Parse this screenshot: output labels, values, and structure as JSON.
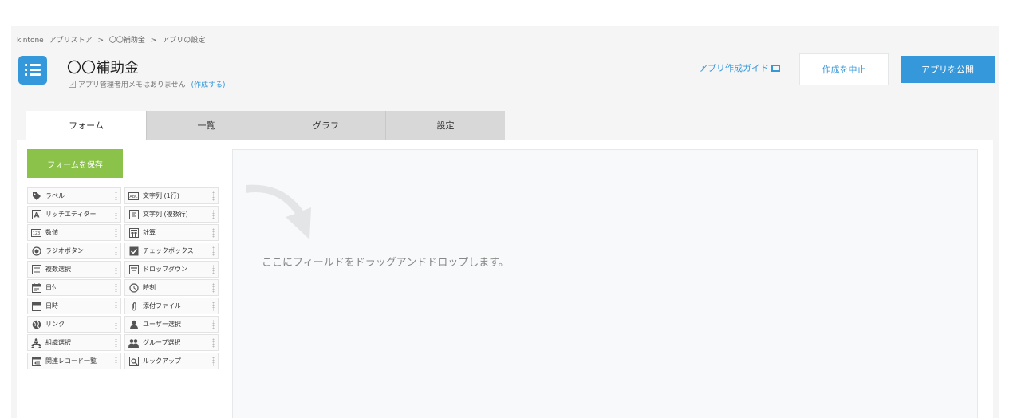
{
  "breadcrumb": [
    {
      "label": "kintone"
    },
    {
      "label": "アプリストア"
    },
    {
      "label": ">"
    },
    {
      "label": "〇〇補助金"
    },
    {
      "label": ">"
    },
    {
      "label": "アプリの設定"
    }
  ],
  "app": {
    "title": "〇〇補助金",
    "memo": "アプリ管理者用メモはありません",
    "memo_link": "(作成する)",
    "icon": "list-icon"
  },
  "header": {
    "guide_link": "アプリ作成ガイド",
    "cancel_label": "作成を中止",
    "publish_label": "アプリを公開"
  },
  "tabs": [
    {
      "label": "フォーム"
    },
    {
      "label": "一覧"
    },
    {
      "label": "グラフ"
    },
    {
      "label": "設定"
    }
  ],
  "form": {
    "save_label": "フォームを保存",
    "drop_hint": "ここにフィールドをドラッグアンドドロップします。",
    "fields": [
      {
        "label": "ラベル",
        "icon": "tag-icon"
      },
      {
        "label": "文字列 (1行)",
        "icon": "abc-icon"
      },
      {
        "label": "リッチエディター",
        "icon": "letter-a-icon"
      },
      {
        "label": "文字列 (複数行)",
        "icon": "multiline-text-icon"
      },
      {
        "label": "数値",
        "icon": "number-icon"
      },
      {
        "label": "計算",
        "icon": "calculator-icon"
      },
      {
        "label": "ラジオボタン",
        "icon": "radio-icon"
      },
      {
        "label": "チェックボックス",
        "icon": "checkbox-icon"
      },
      {
        "label": "複数選択",
        "icon": "multi-select-icon"
      },
      {
        "label": "ドロップダウン",
        "icon": "dropdown-icon"
      },
      {
        "label": "日付",
        "icon": "calendar-icon"
      },
      {
        "label": "時刻",
        "icon": "clock-icon"
      },
      {
        "label": "日時",
        "icon": "datetime-icon"
      },
      {
        "label": "添付ファイル",
        "icon": "paperclip-icon"
      },
      {
        "label": "リンク",
        "icon": "globe-icon"
      },
      {
        "label": "ユーザー選択",
        "icon": "user-icon"
      },
      {
        "label": "組織選択",
        "icon": "org-icon"
      },
      {
        "label": "グループ選択",
        "icon": "group-icon"
      },
      {
        "label": "関連レコード一覧",
        "icon": "related-records-icon"
      },
      {
        "label": "ルックアップ",
        "icon": "lookup-icon"
      }
    ]
  }
}
